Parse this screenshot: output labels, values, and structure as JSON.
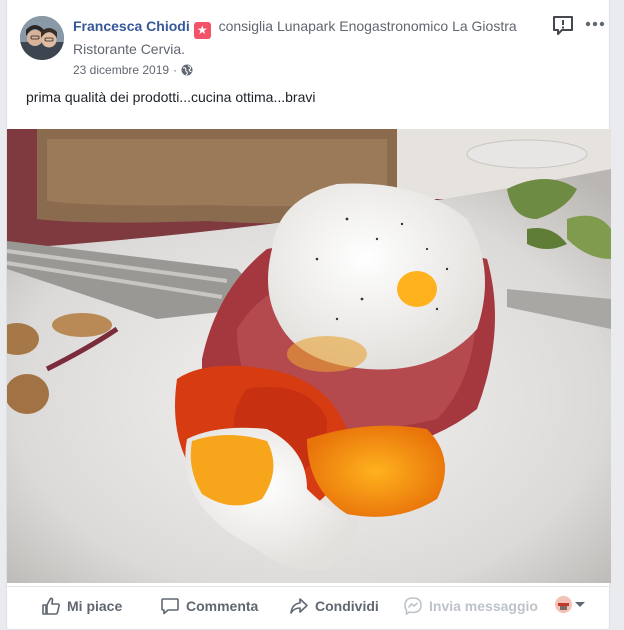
{
  "post": {
    "author": "Francesca Chiodi",
    "action_text": " consiglia Lunapark Enogastronomico La Giostra Ristorante Cervia.",
    "date": "23 dicembre 2019",
    "separator": "·",
    "message": "prima qualità dei prodotti...cucina ottima...bravi",
    "photo_alt": "Foto del piatto",
    "icons": {
      "avatar": "avatar-photo",
      "recommend_badge": "star-icon",
      "privacy": "globe-icon",
      "report": "report-icon",
      "more": "more-dots-icon"
    }
  },
  "actions": {
    "like_label": "Mi piace",
    "comment_label": "Commenta",
    "share_label": "Condividi",
    "message_label": "Invia messaggio",
    "icons": [
      "thumbs-up-icon",
      "comment-icon",
      "share-icon",
      "messenger-icon",
      "audience-selector-icon",
      "chevron-down-icon"
    ]
  },
  "colors": {
    "link": "#365899",
    "meta": "#616770",
    "badge": "#f35369",
    "action_text": "#606770",
    "disabled": "#bec3c9"
  }
}
